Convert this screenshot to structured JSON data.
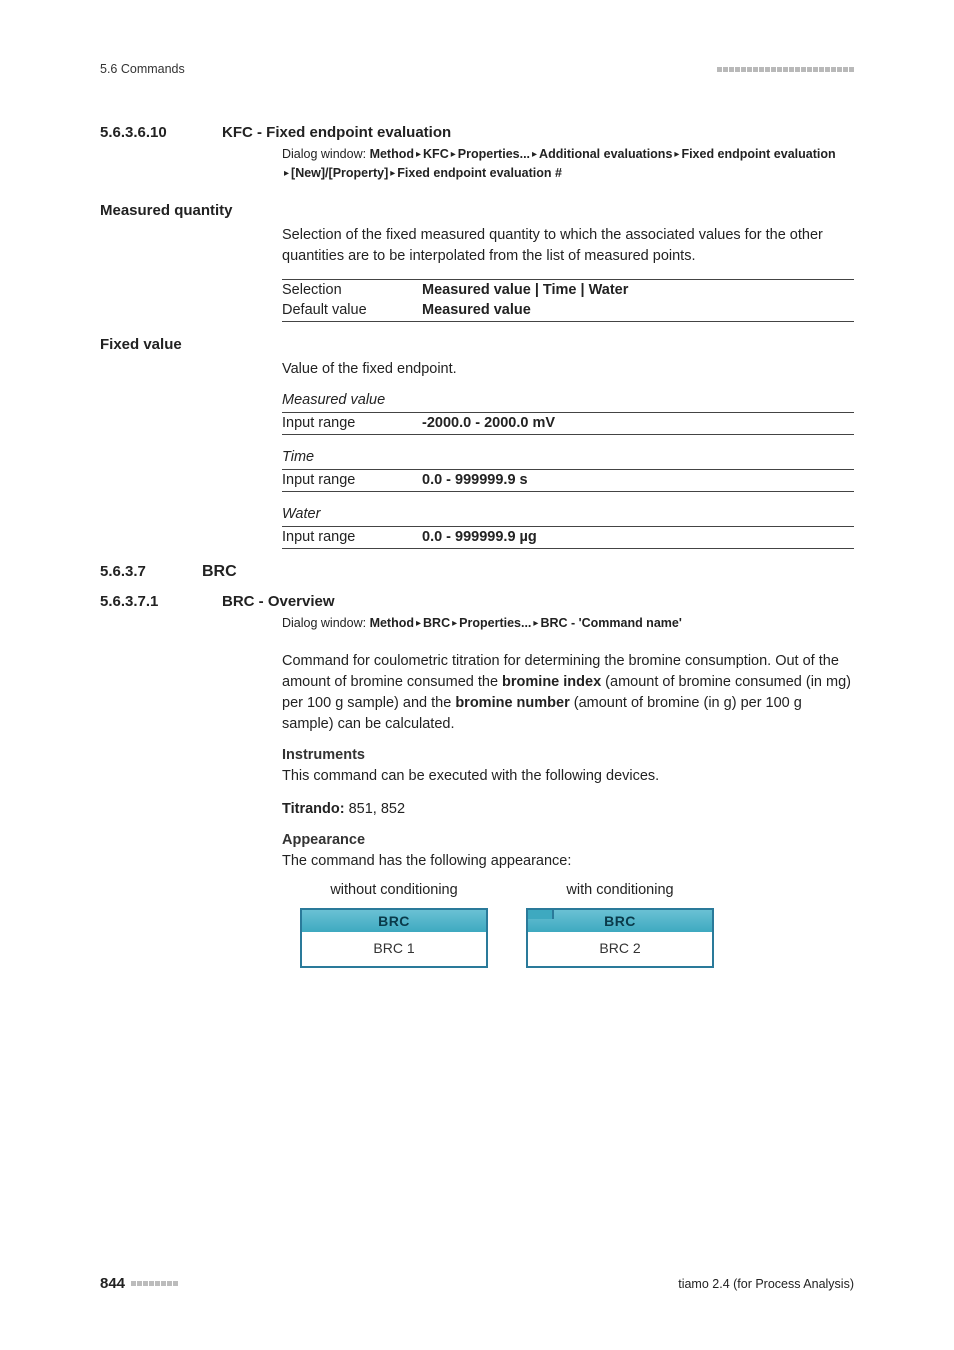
{
  "header": {
    "breadcrumb": "5.6 Commands"
  },
  "sec1": {
    "num": "5.6.3.6.10",
    "title": "KFC - Fixed endpoint evaluation",
    "dialog_label": "Dialog window:",
    "dialog_parts": [
      "Method",
      "KFC",
      "Properties...",
      "Additional evaluations",
      "Fixed endpoint evaluation ",
      "[New]/[Property]",
      "Fixed endpoint evaluation #"
    ]
  },
  "mq": {
    "heading": "Measured quantity",
    "para": "Selection of the fixed measured quantity to which the associated values for the other quantities are to be interpolated from the list of measured points.",
    "rows": [
      {
        "k": "Selection",
        "v": "Measured value | Time | Water"
      },
      {
        "k": "Default value",
        "v": "Measured value"
      }
    ]
  },
  "fv": {
    "heading": "Fixed value",
    "para": "Value of the fixed endpoint.",
    "groups": [
      {
        "label": "Measured value",
        "k": "Input range",
        "v": "-2000.0 - 2000.0 mV"
      },
      {
        "label": "Time",
        "k": "Input range",
        "v": "0.0 - 999999.9 s"
      },
      {
        "label": "Water",
        "k": "Input range",
        "v": "0.0 - 999999.9 µg"
      }
    ]
  },
  "sec2": {
    "num": "5.6.3.7",
    "title": "BRC"
  },
  "sec3": {
    "num": "5.6.3.7.1",
    "title": "BRC - Overview",
    "dialog_label": "Dialog window:",
    "dialog_parts": [
      "Method",
      "BRC",
      "Properties...",
      "BRC - 'Command name'"
    ],
    "para_pre": "Command for coulometric titration for determining the bromine consumption. Out of the amount of bromine consumed the ",
    "b1": "bromine index",
    "para_mid": " (amount of bromine consumed (in mg) per 100 g sample) and the ",
    "b2": "bromine number",
    "para_post": " (amount of bromine (in g) per 100 g sample) can be calculated.",
    "inst_h": "Instruments",
    "inst_p": "This command can be executed with the following devices.",
    "titrando_l": "Titrando:",
    "titrando_v": " 851, 852",
    "app_h": "Appearance",
    "app_p": "The command has the following appearance:",
    "col1": "without conditioning",
    "col2": "with conditioning",
    "brc": "BRC",
    "brc1": "BRC 1",
    "brc2": "BRC 2"
  },
  "footer": {
    "page": "844",
    "product": "tiamo 2.4 (for Process Analysis)"
  }
}
